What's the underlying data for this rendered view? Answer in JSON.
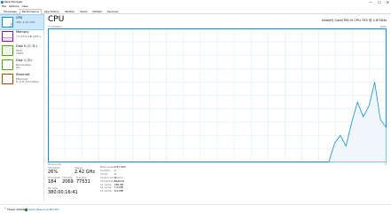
{
  "window": {
    "title": "Task Manager",
    "controls": [
      "—",
      "☐",
      "✕"
    ]
  },
  "menu": [
    "File",
    "Options",
    "View"
  ],
  "tabs": [
    "Processes",
    "Performance",
    "App history",
    "Startup",
    "Users",
    "Details",
    "Services"
  ],
  "active_tab": "Performance",
  "sidebar": {
    "items": [
      {
        "title": "CPU",
        "sub": "26% 2.42 GHz",
        "sub2": "",
        "color": "#1190d0"
      },
      {
        "title": "Memory",
        "sub": "7.1/15.9 GB (45%)",
        "sub2": "",
        "color": "#8b12ae"
      },
      {
        "title": "Disk 0 (C: D:)",
        "sub": "HDD",
        "sub2": "100%",
        "color": "#4da60c"
      },
      {
        "title": "Disk 1 (E:)",
        "sub": "Removable",
        "sub2": "0%",
        "color": "#4da60c"
      },
      {
        "title": "Ethernet",
        "sub": "Ethernet",
        "sub2": "S: 0 R: 16.0 Kbps",
        "color": "#a74f01"
      }
    ]
  },
  "main": {
    "title": "CPU",
    "model": "Intel(R) Core(TM) i5 CPU 750 @ 2.67GHz",
    "graph_label": "% Utilization",
    "graph_max": "100%",
    "axis_left": "60 seconds",
    "axis_right": "0"
  },
  "stats": {
    "utilization_label": "Utilization",
    "utilization": "26%",
    "speed_label": "Speed",
    "speed": "2.42 GHz",
    "processes_label": "Processes",
    "processes": "184",
    "threads_label": "Threads",
    "threads": "2069",
    "handles_label": "Handles",
    "handles": "77531",
    "uptime_label": "Up time",
    "uptime": "380:00:16:41"
  },
  "specs": [
    {
      "k": "Base speed:",
      "v": "2.67 GHz"
    },
    {
      "k": "Sockets:",
      "v": "1"
    },
    {
      "k": "Cores:",
      "v": "4"
    },
    {
      "k": "Logical processors:",
      "v": "4"
    },
    {
      "k": "Virtualization:",
      "v": "Enabled"
    },
    {
      "k": "L1 cache:",
      "v": "256 KB"
    },
    {
      "k": "L2 cache:",
      "v": "1.0 MB"
    },
    {
      "k": "L3 cache:",
      "v": "8.0 MB"
    }
  ],
  "specs_display": [
    {
      "k": "Base speed:",
      "v": "2.67 GHz"
    },
    {
      "k": "Sockets:",
      "v": "1"
    },
    {
      "k": "Cores:",
      "v": "4"
    },
    {
      "k": "Logical processors:",
      "v": "4"
    },
    {
      "k": "Virtualization:",
      "v": "Enabled"
    },
    {
      "k": "L1 cache:",
      "v": "256 KB"
    },
    {
      "k": "L2 cache:",
      "v": "1.0 MB"
    },
    {
      "k": "L3 cache:",
      "v": "8.0 MB"
    }
  ],
  "cpu_history": [
    0,
    0,
    0,
    0,
    0,
    0,
    0,
    0,
    0,
    0,
    0,
    0,
    0,
    0,
    0,
    0,
    0,
    0,
    0,
    0,
    0,
    0,
    0,
    0,
    0,
    0,
    0,
    0,
    0,
    0,
    0,
    0,
    0,
    0,
    0,
    0,
    0,
    0,
    0,
    0,
    0,
    0,
    0,
    0,
    0,
    0,
    0,
    0,
    0,
    0,
    14,
    20,
    12,
    30,
    45,
    34,
    42,
    60,
    32,
    26
  ],
  "bottom": {
    "fewer": "Fewer details",
    "resmon": "Open Resource Monitor"
  },
  "colors": {
    "accent": "#1190d0",
    "graph_fill": "#f1f6fa",
    "grid": "#d9eaf7"
  }
}
